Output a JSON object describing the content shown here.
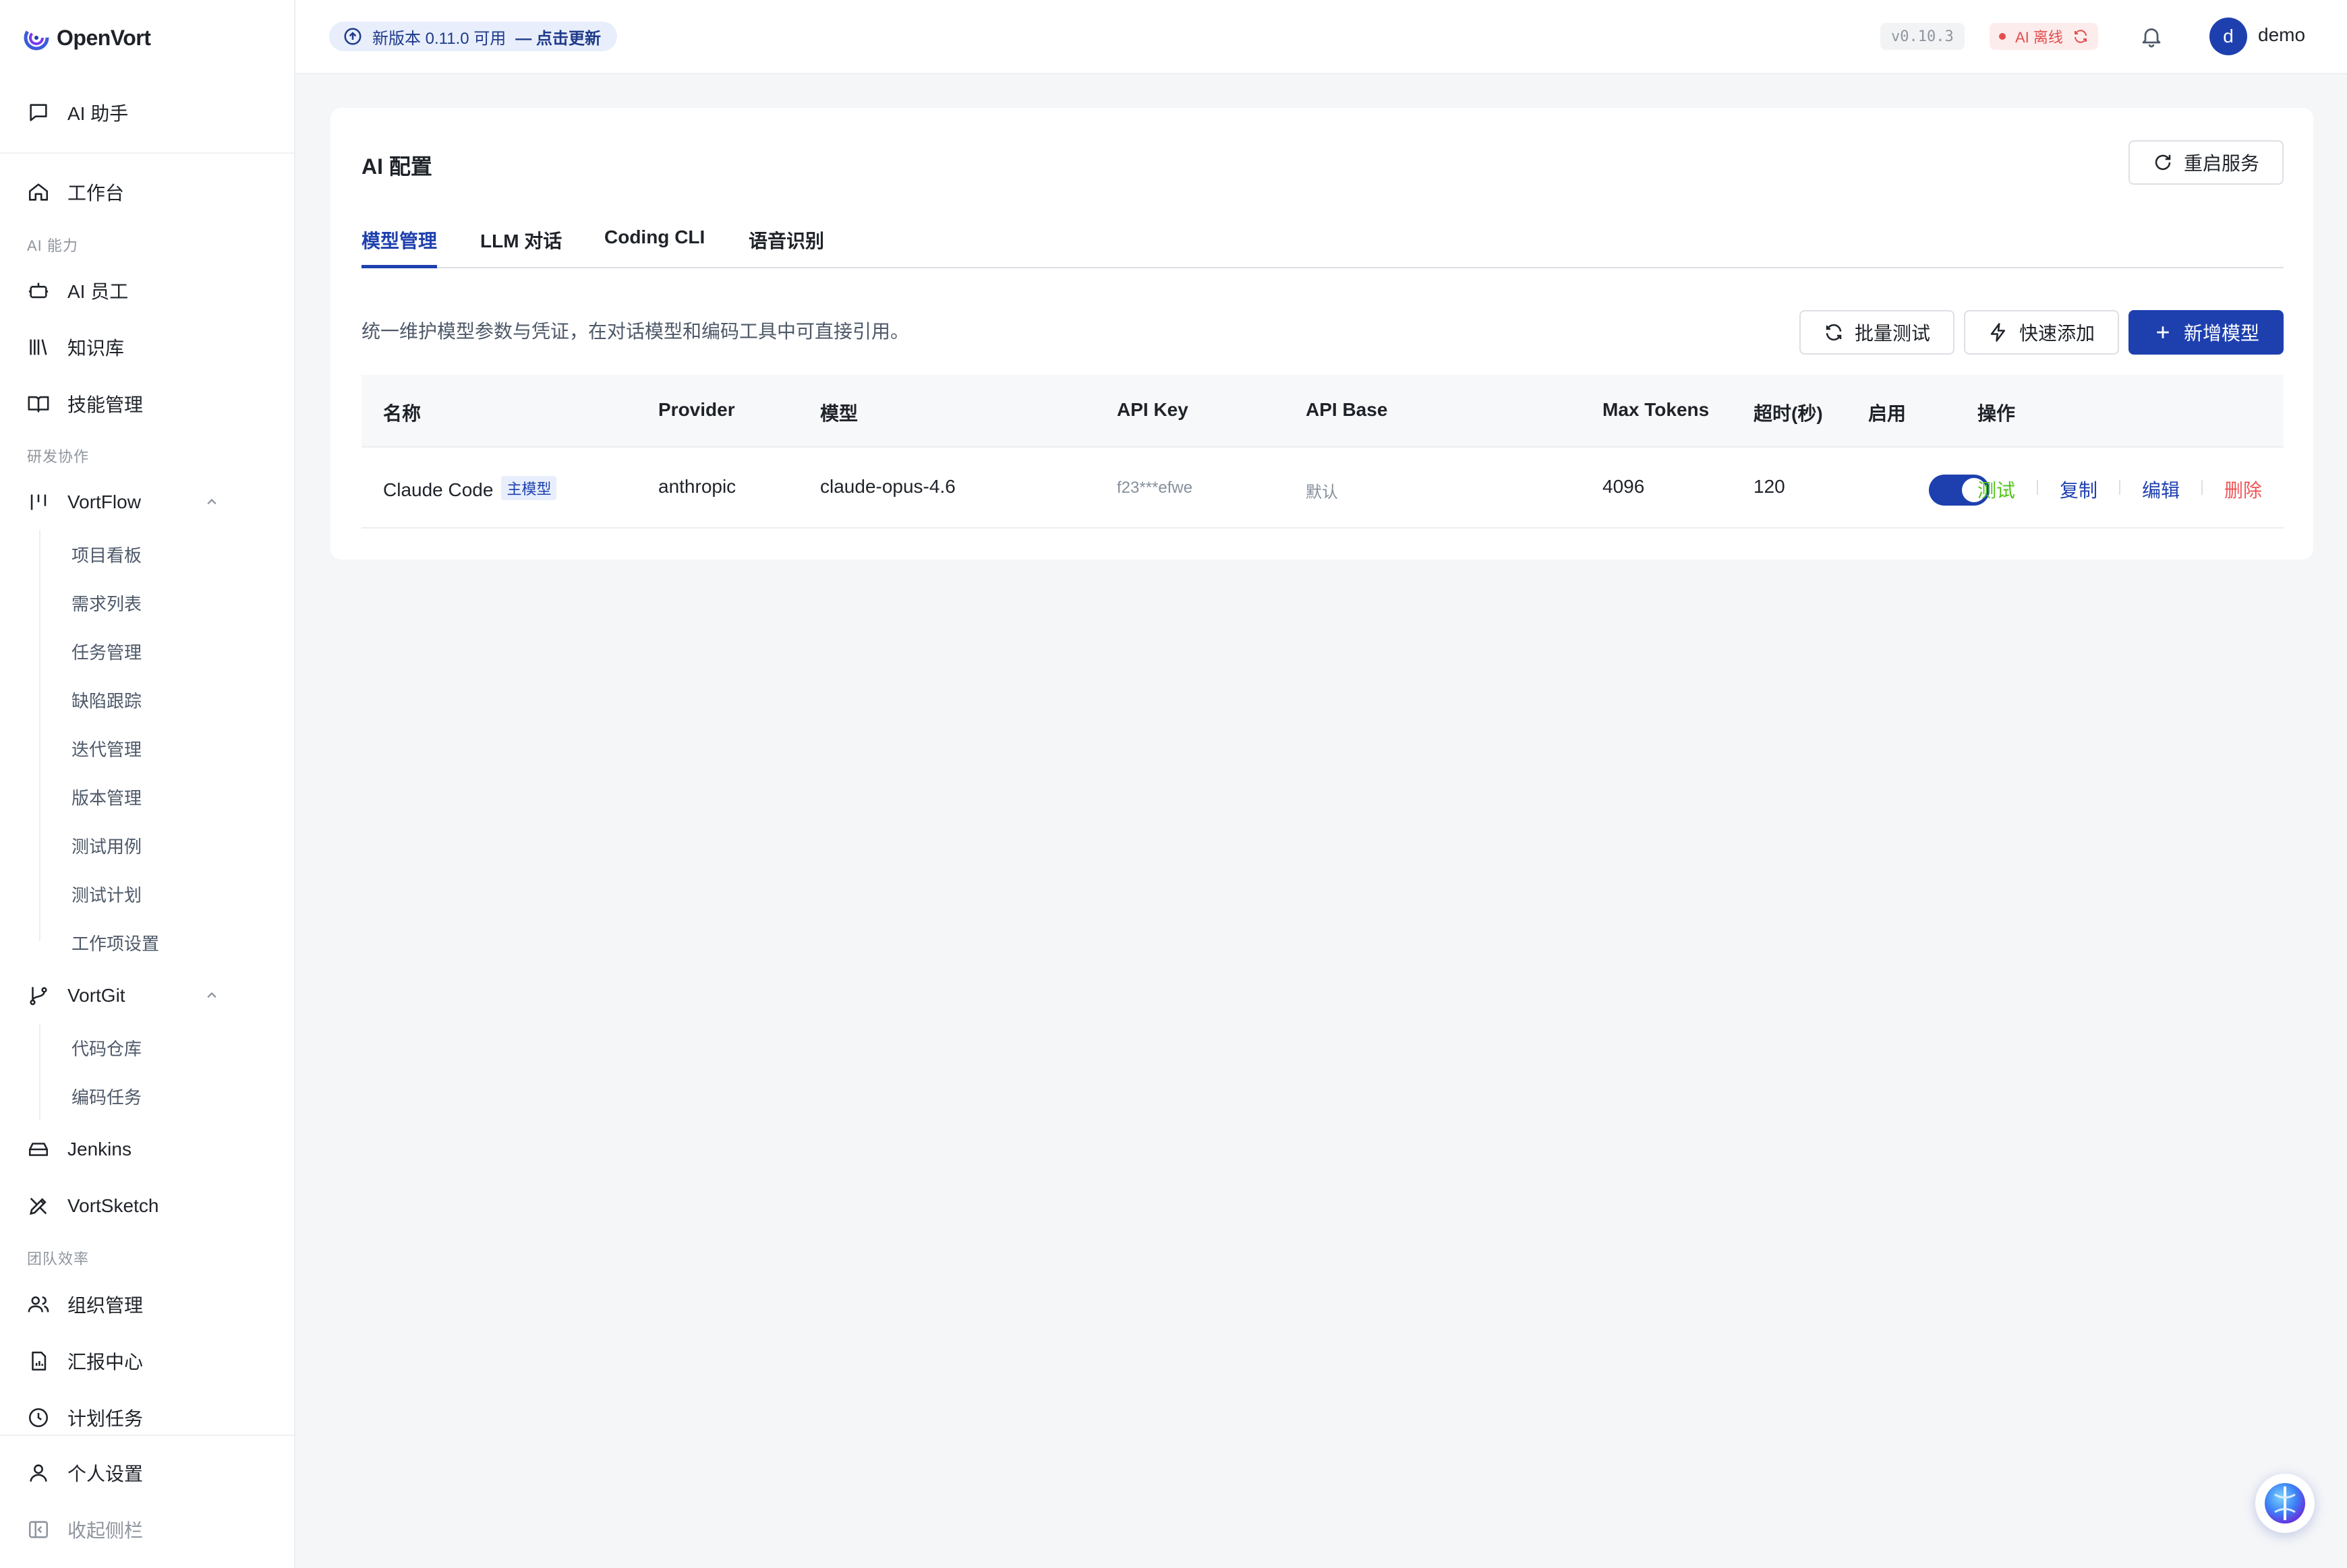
{
  "app": {
    "name": "OpenVort"
  },
  "sidebar": {
    "ai_assistant": "AI 助手",
    "workbench": "工作台",
    "section_ai": "AI 能力",
    "ai_staff": "AI 员工",
    "knowledge": "知识库",
    "skills": "技能管理",
    "section_dev": "研发协作",
    "vortflow": {
      "label": "VortFlow",
      "items": [
        "项目看板",
        "需求列表",
        "任务管理",
        "缺陷跟踪",
        "迭代管理",
        "版本管理",
        "测试用例",
        "测试计划",
        "工作项设置"
      ]
    },
    "vortgit": {
      "label": "VortGit",
      "items": [
        "代码仓库",
        "编码任务"
      ]
    },
    "jenkins": "Jenkins",
    "vortsketch": "VortSketch",
    "section_team": "团队效率",
    "org": "组织管理",
    "report": "汇报中心",
    "schedule": "计划任务",
    "settings": "个人设置",
    "collapse": "收起侧栏"
  },
  "topbar": {
    "update_text": "新版本 0.11.0 可用",
    "update_link": "— 点击更新",
    "version": "v0.10.3",
    "ai_status": "AI 离线",
    "avatar_letter": "d",
    "username": "demo"
  },
  "page": {
    "title": "AI 配置",
    "restart_label": "重启服务",
    "tabs": [
      "模型管理",
      "LLM 对话",
      "Coding CLI",
      "语音识别"
    ],
    "active_tab": "模型管理",
    "description": "统一维护模型参数与凭证，在对话模型和编码工具中可直接引用。",
    "batch_test_label": "批量测试",
    "quick_add_label": "快速添加",
    "add_model_label": "新增模型"
  },
  "table": {
    "columns": [
      "名称",
      "Provider",
      "模型",
      "API Key",
      "API Base",
      "Max Tokens",
      "超时(秒)",
      "启用",
      "操作"
    ],
    "rows": [
      {
        "name": "Claude Code",
        "tag": "主模型",
        "provider": "anthropic",
        "model": "claude-opus-4.6",
        "api_key": "f23***efwe",
        "api_base": "默认",
        "max_tokens": "4096",
        "timeout": "120",
        "enabled": true,
        "actions": {
          "test": "测试",
          "copy": "复制",
          "edit": "编辑",
          "delete": "删除"
        }
      }
    ]
  },
  "colors": {
    "primary": "#1e40af",
    "test_green": "#52c41a",
    "delete_red": "#f05656",
    "status_red": "#e34d4d"
  }
}
